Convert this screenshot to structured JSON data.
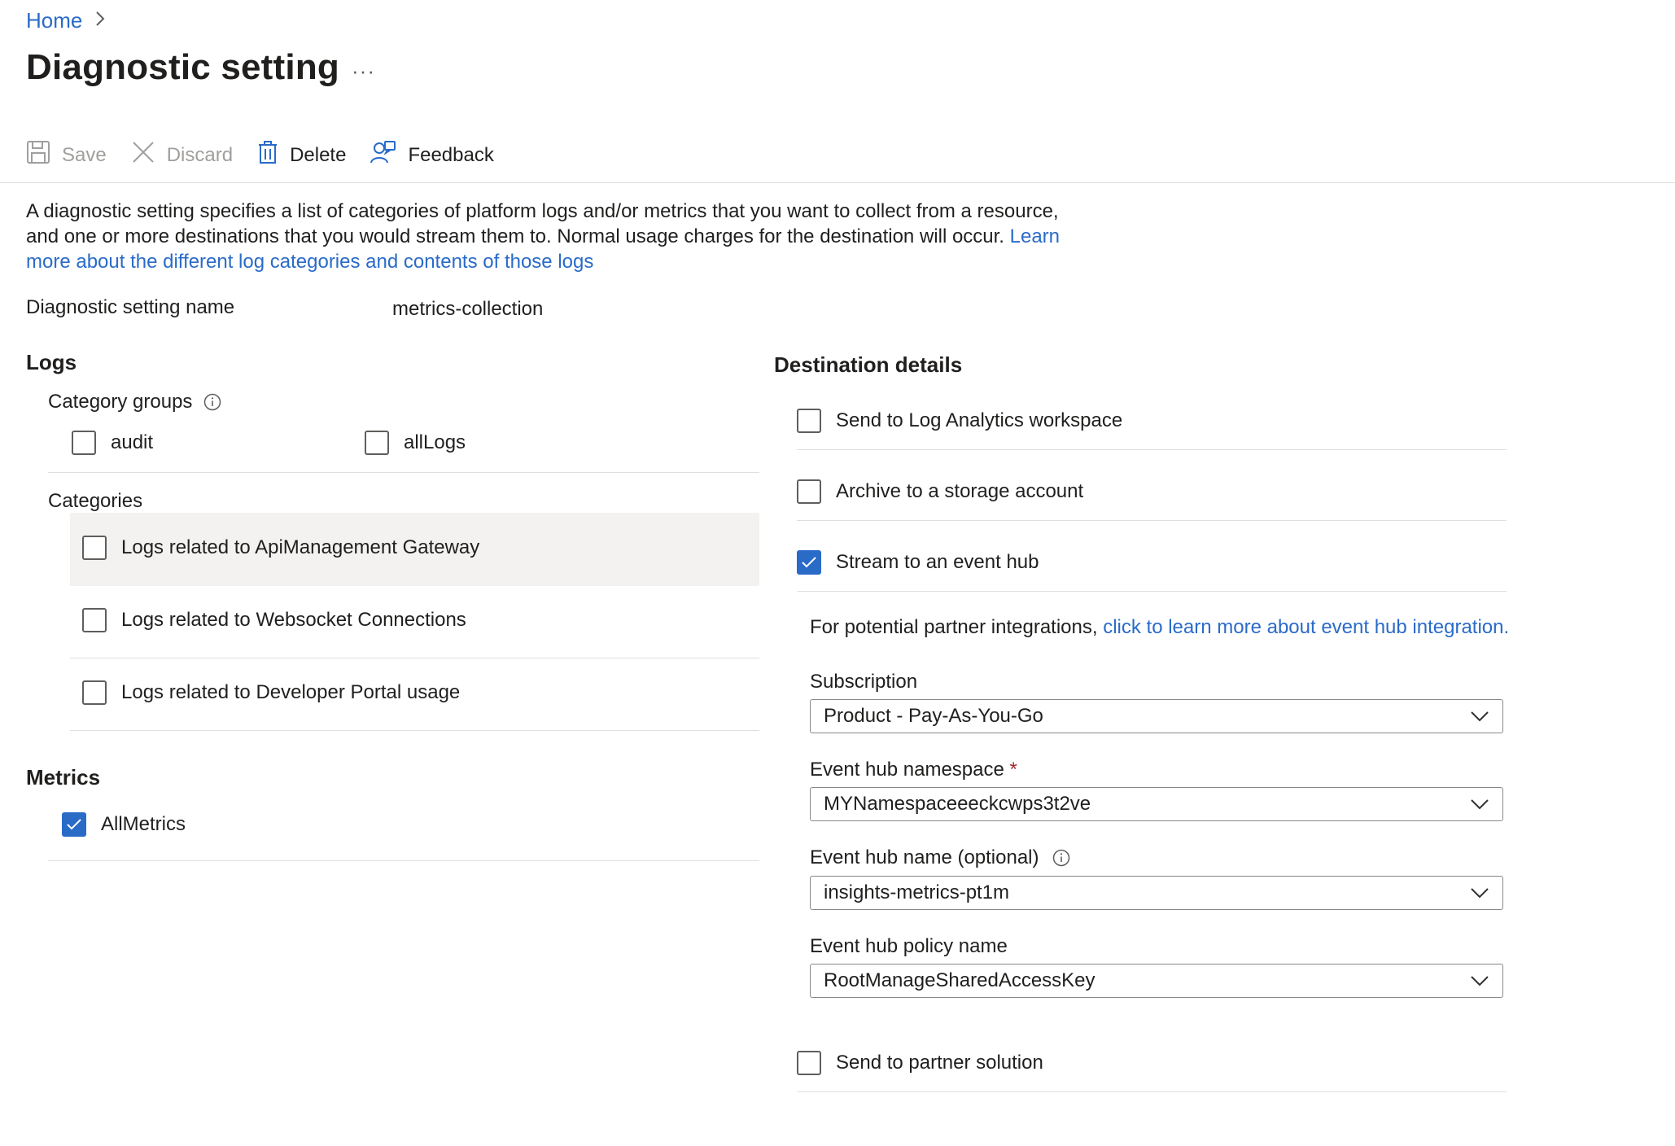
{
  "breadcrumb": {
    "home": "Home",
    "separator": "›"
  },
  "page": {
    "title": "Diagnostic setting",
    "more": "···"
  },
  "toolbar": {
    "save": "Save",
    "discard": "Discard",
    "delete": "Delete",
    "feedback": "Feedback"
  },
  "description": {
    "text": "A diagnostic setting specifies a list of categories of platform logs and/or metrics that you want to collect from a resource, and one or more destinations that you would stream them to. Normal usage charges for the destination will occur.",
    "link": "Learn more about the different log categories and contents of those logs"
  },
  "setting_name": {
    "label": "Diagnostic setting name",
    "value": "metrics-collection"
  },
  "logs": {
    "heading": "Logs",
    "category_groups_label": "Category groups",
    "category_groups": [
      {
        "label": "audit",
        "checked": false
      },
      {
        "label": "allLogs",
        "checked": false
      }
    ],
    "categories_label": "Categories",
    "categories": [
      {
        "label": "Logs related to ApiManagement Gateway",
        "checked": false
      },
      {
        "label": "Logs related to Websocket Connections",
        "checked": false
      },
      {
        "label": "Logs related to Developer Portal usage",
        "checked": false
      }
    ]
  },
  "metrics": {
    "heading": "Metrics",
    "items": [
      {
        "label": "AllMetrics",
        "checked": true
      }
    ]
  },
  "destination": {
    "heading": "Destination details",
    "options": [
      {
        "label": "Send to Log Analytics workspace",
        "checked": false
      },
      {
        "label": "Archive to a storage account",
        "checked": false
      },
      {
        "label": "Stream to an event hub",
        "checked": true
      }
    ],
    "partner_note": "For potential partner integrations,",
    "partner_link": "click to learn more about event hub integration.",
    "subscription": {
      "label": "Subscription",
      "value": "Product - Pay-As-You-Go"
    },
    "namespace": {
      "label": "Event hub namespace",
      "required": "*",
      "value": "MYNamespaceeeckcwps3t2ve"
    },
    "hub_name": {
      "label": "Event hub name (optional)",
      "value": "insights-metrics-pt1m"
    },
    "policy": {
      "label": "Event hub policy name",
      "value": "RootManageSharedAccessKey"
    },
    "partner_solution": {
      "label": "Send to partner solution",
      "checked": false
    }
  },
  "colors": {
    "accent": "#2a6bc8",
    "hover_row": "#f3f2f1",
    "divider": "#e1dfdd",
    "required": "#a4262c"
  }
}
